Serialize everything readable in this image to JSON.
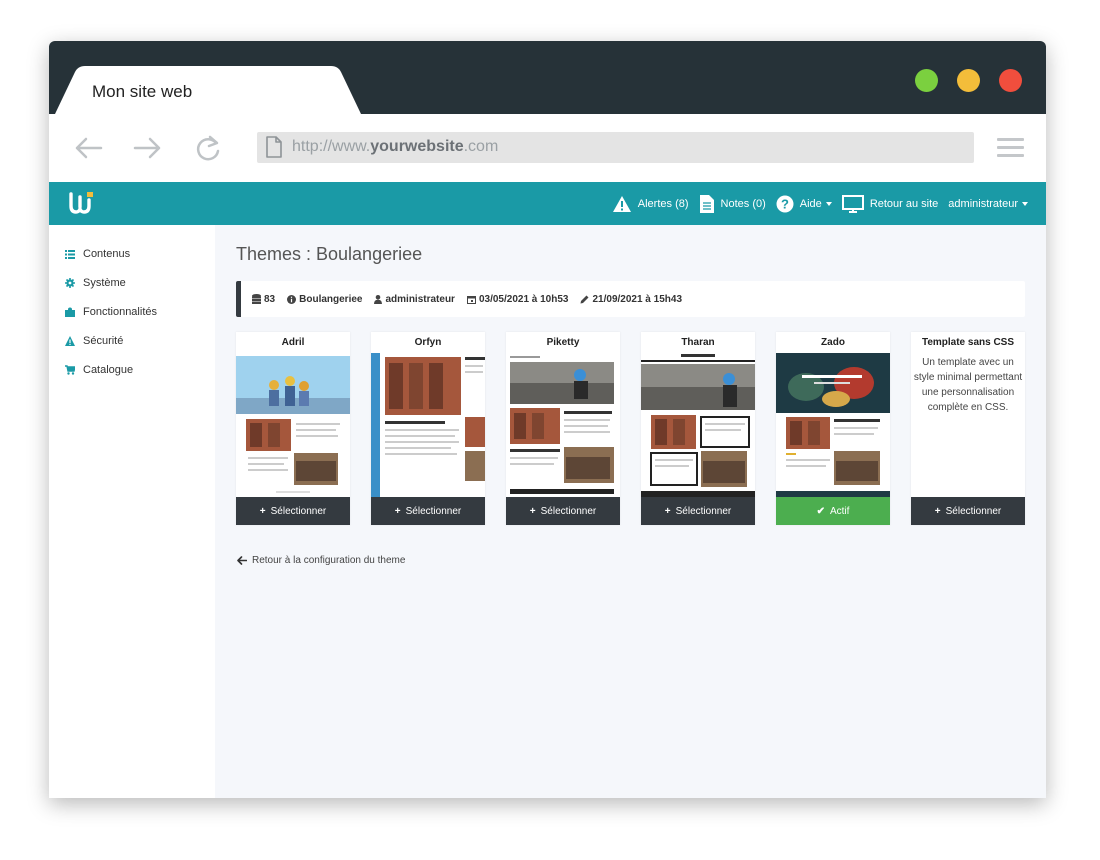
{
  "browser": {
    "tab_title": "Mon site web",
    "url_prefix": "http://www.",
    "url_domain": "yourwebsite",
    "url_suffix": ".com"
  },
  "topnav": {
    "alerts": "Alertes (8)",
    "notes": "Notes (0)",
    "help": "Aide",
    "back_to_site": "Retour au site",
    "user": "administrateur"
  },
  "sidebar": {
    "items": [
      {
        "label": "Contenus",
        "icon": "list-icon"
      },
      {
        "label": "Système",
        "icon": "gear-icon"
      },
      {
        "label": "Fonctionnalités",
        "icon": "puzzle-icon"
      },
      {
        "label": "Sécurité",
        "icon": "warning-icon"
      },
      {
        "label": "Catalogue",
        "icon": "cart-icon"
      }
    ]
  },
  "page": {
    "title": "Themes : Boulangeriee",
    "info": {
      "count": "83",
      "name": "Boulangeriee",
      "author": "administrateur",
      "created": "03/05/2021 à 10h53",
      "modified": "21/09/2021 à 15h43"
    },
    "themes": [
      {
        "name": "Adril",
        "button": "Sélectionner",
        "active": false
      },
      {
        "name": "Orfyn",
        "button": "Sélectionner",
        "active": false
      },
      {
        "name": "Piketty",
        "button": "Sélectionner",
        "active": false
      },
      {
        "name": "Tharan",
        "button": "Sélectionner",
        "active": false
      },
      {
        "name": "Zado",
        "button": "Actif",
        "active": true
      },
      {
        "name": "Template sans CSS",
        "button": "Sélectionner",
        "active": false,
        "description": "Un template avec un style minimal permettant une personnalisation complète en CSS."
      }
    ],
    "back_link": "Retour à la configuration du theme"
  },
  "colors": {
    "titlebar": "#263238",
    "appbar": "#1a9aa6",
    "button_dark": "#343a40",
    "button_active": "#4cae4f",
    "dot_green": "#7bd03f",
    "dot_yellow": "#f3bd3a",
    "dot_red": "#f14e3d"
  }
}
